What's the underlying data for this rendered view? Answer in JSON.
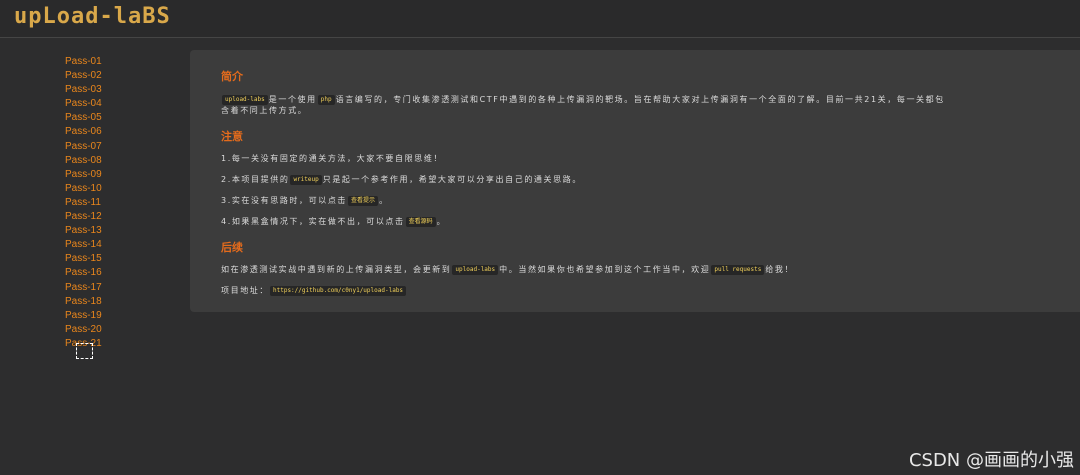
{
  "header": {
    "logo_text": "upLoad-laBS"
  },
  "sidebar": {
    "items": [
      "Pass-01",
      "Pass-02",
      "Pass-03",
      "Pass-04",
      "Pass-05",
      "Pass-06",
      "Pass-07",
      "Pass-08",
      "Pass-09",
      "Pass-10",
      "Pass-11",
      "Pass-12",
      "Pass-13",
      "Pass-14",
      "Pass-15",
      "Pass-16",
      "Pass-17",
      "Pass-18",
      "Pass-19",
      "Pass-20",
      "Pass-21"
    ]
  },
  "content": {
    "intro_title": "简介",
    "intro": {
      "code1": "upload-labs",
      "text1": "是一个使用",
      "code2": "php",
      "text2": "语言编写的，专门收集渗透测试和CTF中遇到的各种上传漏洞的靶场。旨在帮助大家对上传漏洞有一个全面的了解。目前一共21关，每一关都包",
      "line2": "含着不同上传方式。"
    },
    "notes_title": "注意",
    "notes": {
      "n1": "1.每一关没有固定的通关方法，大家不要自限思维！",
      "n2_a": "2.本项目提供的",
      "n2_code": "writeup",
      "n2_b": "只是起一个参考作用，希望大家可以分享出自己的通关思路。",
      "n3_a": "3.实在没有思路时，可以点击",
      "n3_code": "查看提示",
      "n3_b": "。",
      "n4_a": "4.如果黑盒情况下，实在做不出，可以点击",
      "n4_code": "查看源码",
      "n4_b": "。"
    },
    "followup_title": "后续",
    "followup": {
      "a": "如在渗透测试实战中遇到新的上传漏洞类型，会更新到",
      "code1": "upload-labs",
      "b": "中。当然如果你也希望参加到这个工作当中，欢迎",
      "code2": "pull requests",
      "c": "给我！"
    },
    "project": {
      "label": "项目地址：",
      "url": "https://github.com/c0ny1/upload-labs"
    }
  },
  "watermark": "CSDN @画画的小强",
  "colors": {
    "accent": "#e9861c",
    "section_title": "#e46b1c",
    "code_text": "#f2d15a",
    "background": "#2d2d2e",
    "panel": "#3c3c3c"
  }
}
